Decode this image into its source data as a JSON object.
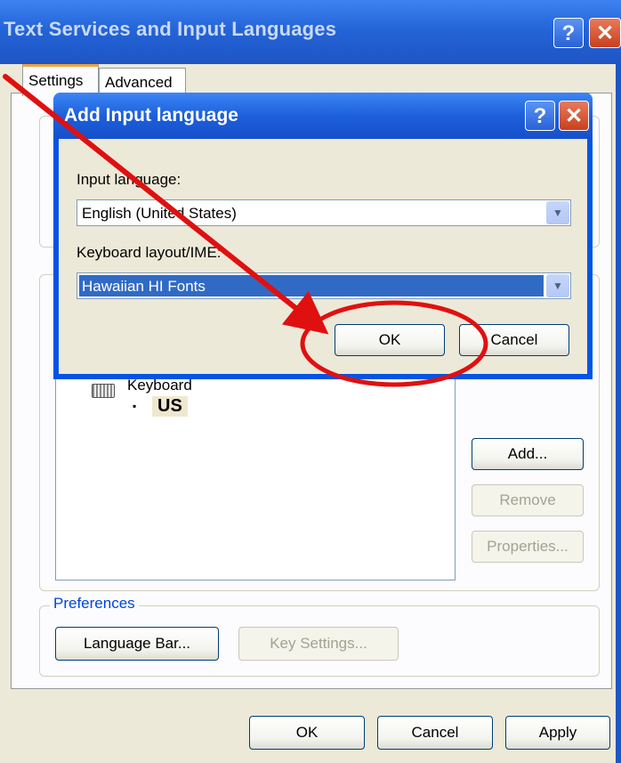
{
  "outer": {
    "title": "Text Services and Input Languages",
    "help_glyph": "?",
    "close_glyph": "✕",
    "tabs": [
      {
        "label": "Settings",
        "active": true
      },
      {
        "label": "Advanced",
        "active": false
      }
    ],
    "installed": {
      "keyboard_label": "Keyboard",
      "bullet": "▪",
      "layout": "US"
    },
    "side_buttons": {
      "add": "Add...",
      "remove": "Remove",
      "properties": "Properties..."
    },
    "preferences": {
      "label": "Preferences",
      "language_bar": "Language Bar...",
      "key_settings": "Key Settings..."
    },
    "footer": {
      "ok": "OK",
      "cancel": "Cancel",
      "apply": "Apply"
    }
  },
  "inner": {
    "title": "Add Input language",
    "help_glyph": "?",
    "close_glyph": "✕",
    "input_language_label": "Input language:",
    "input_language_value": "English (United States)",
    "keyboard_layout_label": "Keyboard layout/IME:",
    "keyboard_layout_value": "Hawaiian HI Fonts",
    "ok": "OK",
    "cancel": "Cancel"
  },
  "combo_arrow": "▼",
  "colors": {
    "annotation_red": "#e01010",
    "title_blue": "#2464d8",
    "dialog_face": "#ece9d8"
  }
}
